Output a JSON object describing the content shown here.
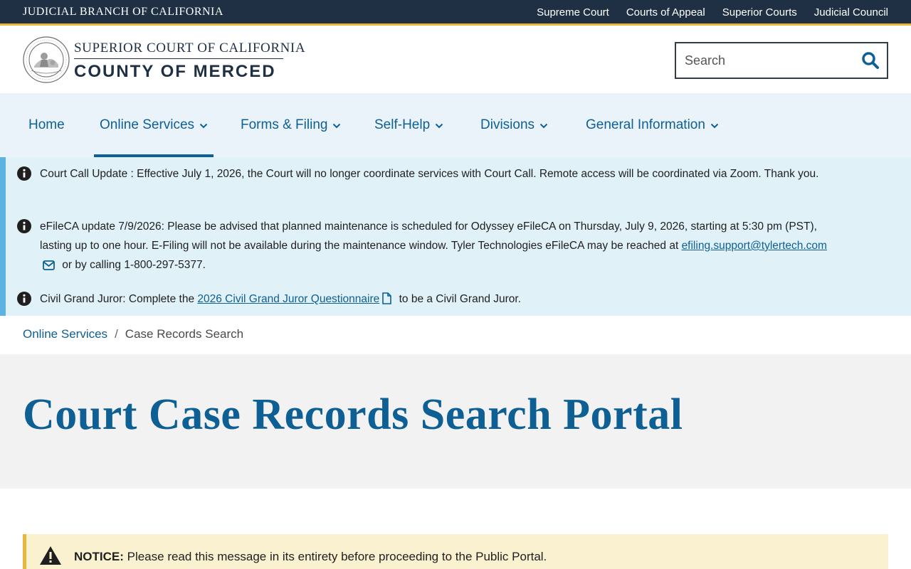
{
  "utility": {
    "brand": "JUDICIAL BRANCH OF CALIFORNIA",
    "links": [
      "Supreme Court",
      "Courts of Appeal",
      "Superior Courts",
      "Judicial Council"
    ]
  },
  "header": {
    "court_line1": "SUPERIOR COURT OF CALIFORNIA",
    "court_line2": "COUNTY OF MERCED",
    "search_placeholder": "Search"
  },
  "nav": {
    "items": [
      {
        "label": "Home"
      },
      {
        "label": "Online Services"
      },
      {
        "label": "Forms & Filing"
      },
      {
        "label": "Self-Help"
      },
      {
        "label": "Divisions"
      },
      {
        "label": "General Information"
      }
    ],
    "active": "Online Services"
  },
  "alerts": [
    {
      "text": "Court Call Update : Effective July 1, 2026, the Court will no longer coordinate services with Court Call. Remote access will be coordinated via Zoom. Thank you."
    },
    {
      "text_before": "eFileCA update 7/9/2026: Please be advised that planned maintenance is scheduled for Odyssey eFileCA on Thursday, July 9, 2026, starting at 5:30 pm (PST), lasting up to one hour. E-Filing will not be available during the maintenance window. Tyler Technologies eFileCA may be reached at ",
      "link": "efiling.support@tylertech.com",
      "text_after": " or by calling 1-800-297-5377."
    },
    {
      "text_before": "Civil Grand Juror: Complete the ",
      "link": "2026 Civil Grand Juror Questionnaire",
      "text_after": " to be a Civil Grand Juror."
    }
  ],
  "breadcrumb": {
    "parent": "Online Services",
    "separator": "/",
    "current": "Case Records Search"
  },
  "page": {
    "title": "Court Case Records Search Portal"
  },
  "notice": {
    "label": "NOTICE:",
    "text": " Please read this message in its entirety before proceeding to the Public Portal."
  },
  "colors": {
    "utility_bg": "#1f3044",
    "gold_accent": "#e8b740",
    "link_blue": "#0d5f94",
    "nav_bg": "#eaf3fa",
    "alert_bg": "#e0f1f8",
    "notice_bg": "#faf1d0"
  }
}
